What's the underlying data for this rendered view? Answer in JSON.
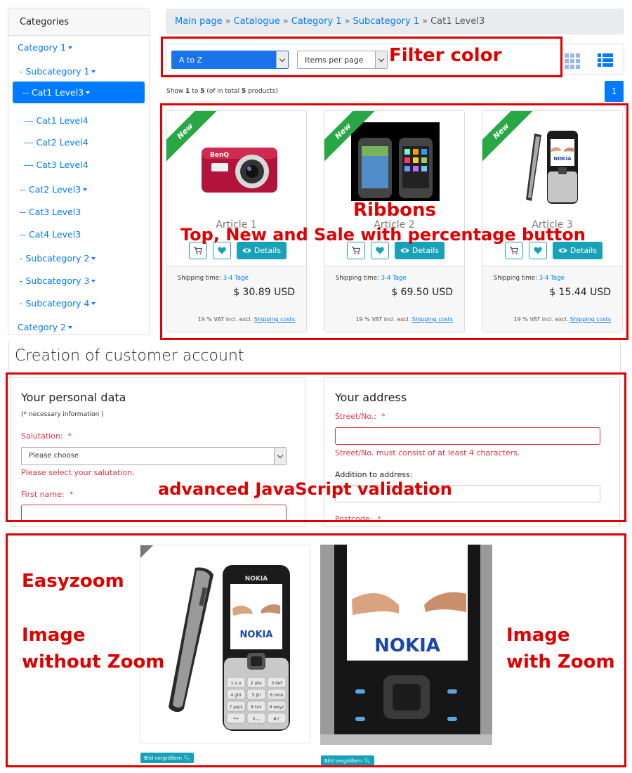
{
  "sidebar": {
    "title": "Categories",
    "items": [
      {
        "label": "Category 1",
        "caret": true
      },
      {
        "label": "- Subcategory 1",
        "caret": true
      },
      {
        "label": "-- Cat1 Level3",
        "caret": true,
        "active": true
      },
      {
        "label": "--- Cat1 Level4",
        "caret": false
      },
      {
        "label": "--- Cat2 Level4",
        "caret": false
      },
      {
        "label": "--- Cat3 Level4",
        "caret": false
      },
      {
        "label": "-- Cat2 Level3",
        "caret": true
      },
      {
        "label": "-- Cat3 Level3",
        "caret": false
      },
      {
        "label": "-- Cat4 Level3",
        "caret": false
      },
      {
        "label": "- Subcategory 2",
        "caret": true
      },
      {
        "label": "- Subcategory 3",
        "caret": true
      },
      {
        "label": "- Subcategory 4",
        "caret": true
      },
      {
        "label": "Category 2",
        "caret": true
      }
    ]
  },
  "breadcrumb": {
    "items": [
      "Main page",
      "Catalogue",
      "Category 1",
      "Subcategory 1"
    ],
    "current": "Cat1 Level3",
    "separator": "»"
  },
  "filter": {
    "sort_value": "A to Z",
    "per_page_value": "Items per page"
  },
  "listing": {
    "show_prefix": "Show",
    "from": "1",
    "to_word": "to",
    "to": "5",
    "of_prefix": "(of in total",
    "total": "5",
    "of_suffix": "products)",
    "page": "1"
  },
  "products": [
    {
      "ribbon": "New",
      "title": "Article 1",
      "shipping_label": "Shipping time:",
      "shipping_value": "3-4 Tage",
      "price": "$ 30.89 USD",
      "vat": "19 % VAT incl. excl.",
      "shipping_costs": "Shipping costs",
      "details": "Details",
      "image": "red-camera"
    },
    {
      "ribbon": "New",
      "title": "Article 2",
      "shipping_label": "Shipping time:",
      "shipping_value": "3-4 Tage",
      "price": "$ 69.50 USD",
      "vat": "19 % VAT incl. excl.",
      "shipping_costs": "Shipping costs",
      "details": "Details",
      "image": "iphone-pair"
    },
    {
      "ribbon": "New",
      "title": "Article 3",
      "shipping_label": "Shipping time:",
      "shipping_value": "3-4 Tage",
      "price": "$ 15.44 USD",
      "vat": "19 % VAT incl. excl.",
      "shipping_costs": "Shipping costs",
      "details": "Details",
      "image": "nokia-phone"
    }
  ],
  "account": {
    "title": "Creation of customer account",
    "personal": {
      "title": "Your personal data",
      "note": "(* necessary information )",
      "salutation_label": "Salutation:",
      "salutation_placeholder": "Please choose",
      "salutation_error": "Please select your salutation.",
      "firstname_label": "First name:"
    },
    "address": {
      "title": "Your address",
      "street_label": "Street/No.:",
      "street_error": "Street/No. must consist of at least 4 characters.",
      "addition_label": "Addition to address:",
      "postcode_label": "Postcode:"
    },
    "required_mark": "*"
  },
  "zoom": {
    "button_label": "Bild vergrößern",
    "phone_brand": "NOKIA",
    "keypad": [
      "1 o.o",
      "2 abc",
      "3 def",
      "4 ghi",
      "5 jkl",
      "6 mno",
      "7 pqrs",
      "8 tuv",
      "9 wxyz",
      "*+",
      "0 ⌴",
      "#⇧"
    ]
  },
  "annotations": {
    "filter_color": "Filter color",
    "ribbons": "Ribbons",
    "ribbons_sub": "Top, New and Sale with percentage button",
    "validation": "advanced JavaScript validation",
    "easyzoom": "Easyzoom",
    "without_zoom_1": "Image",
    "without_zoom_2": "without Zoom",
    "with_zoom_1": "Image",
    "with_zoom_2": "with Zoom"
  },
  "colors": {
    "primary": "#007bff",
    "info": "#17a2b8",
    "ribbon_green": "#28a745",
    "error": "#dc3545",
    "annotation_red": "#e00000"
  }
}
